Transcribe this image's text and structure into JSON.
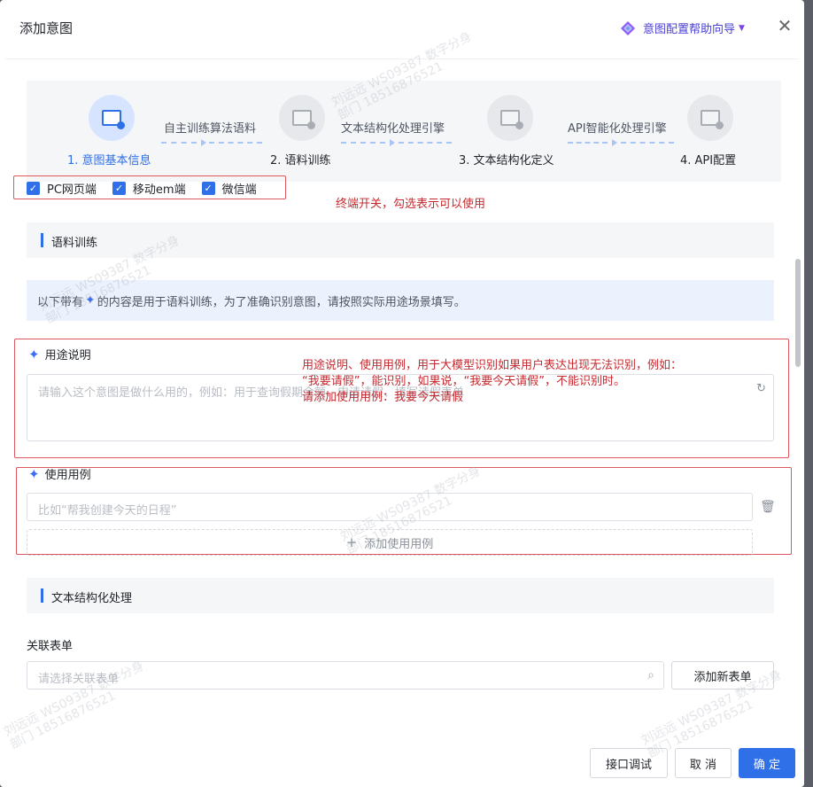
{
  "dialog": {
    "title": "添加意图",
    "help_label": "意图配置帮助向导",
    "close_symbol": "✕"
  },
  "steps": [
    {
      "label": "1. 意图基本信息",
      "active": true
    },
    {
      "label": "2. 语料训练",
      "active": false
    },
    {
      "label": "3. 文本结构化定义",
      "active": false
    },
    {
      "label": "4. API配置",
      "active": false
    }
  ],
  "connectors": [
    "自主训练算法语料",
    "文本结构化处理引擎",
    "API智能化处理引擎"
  ],
  "terminals": [
    {
      "label": "PC网页端",
      "checked": true
    },
    {
      "label": "移动em端",
      "checked": true
    },
    {
      "label": "微信端",
      "checked": true
    }
  ],
  "annotations": {
    "terminal_note": "终端开关，勾选表示可以使用",
    "usage_note_line1": "用途说明、使用用例，用于大模型识别如果用户表达出现无法识别，例如：",
    "usage_note_line2": "“我要请假”，能识别，如果说，“我要今天请假”，不能识别时。",
    "usage_note_line3": "请添加使用用例：我要今天请假"
  },
  "corpus_section": {
    "title": "语料训练",
    "notice_prefix": "以下带有",
    "notice_suffix": "的内容是用于语料训练，为了准确识别意图，请按照实际用途场景填写。",
    "usage_label": "用途说明",
    "usage_placeholder": "请输入这个意图是做什么用的，例如：用于查询假期余额、申请请假、填写请假表单",
    "example_label": "使用用例",
    "example_placeholder": "比如“帮我创建今天的日程”",
    "add_example_label": "添加使用用例"
  },
  "text_section": {
    "title": "文本结构化处理",
    "form_label": "关联表单",
    "form_placeholder": "请选择关联表单",
    "add_form_label": "添加新表单"
  },
  "footer": {
    "test_label": "接口调试",
    "cancel_label": "取 消",
    "confirm_label": "确 定"
  },
  "watermark": {
    "name": "刘远远 WS09387 数字分身",
    "dept": "部门 18516876521"
  },
  "colors": {
    "primary": "#2f6fe8",
    "annotation_red": "#c5292f",
    "help_purple": "#4a3fd4"
  }
}
